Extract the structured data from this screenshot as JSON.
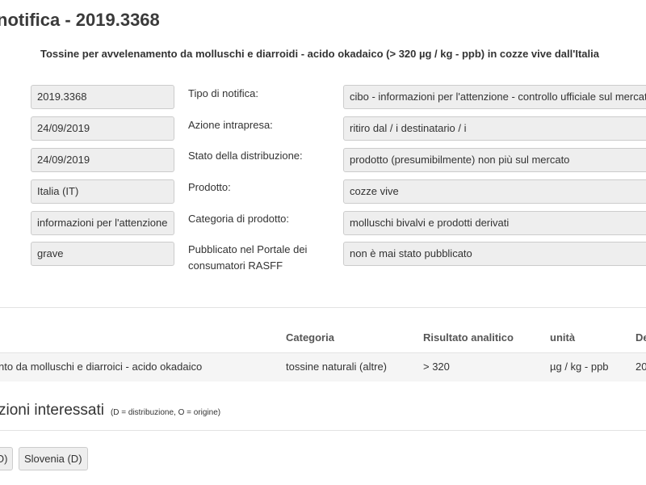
{
  "header": {
    "title": "notifica - 2019.3368",
    "subtitle": "Tossine per avvelenamento da molluschi e diarroidi - acido okadaico (> 320 µg / kg - ppb) in cozze vive dall'Italia"
  },
  "details": {
    "left_values": [
      "2019.3368",
      "24/09/2019",
      "24/09/2019",
      "Italia (IT)",
      "informazioni per l'attenzione",
      "grave"
    ],
    "labels": [
      "Tipo di notifica:",
      "Azione intrapresa:",
      "Stato della distribuzione:",
      "Prodotto:",
      "Categoria di prodotto:",
      "Pubblicato nel Portale dei consumatori RASFF"
    ],
    "right_values": [
      "cibo - informazioni per l'attenzione - controllo ufficiale sul mercato",
      "ritiro dal / i destinatario / i",
      "prodotto (presumibilmente) non più sul mercato",
      "cozze vive",
      "molluschi bivalvi e prodotti derivati",
      "non è mai stato pubblicato"
    ]
  },
  "hazards_table": {
    "headers": [
      "Categoria",
      "Risultato analitico",
      "unità",
      "De"
    ],
    "row": {
      "hazard": "nto da molluschi e diarroici - acido okadaico",
      "category": "tossine naturali (altre)",
      "result": "> 320",
      "unit": "µg / kg - ppb",
      "date": "20"
    }
  },
  "countries": {
    "heading": "zioni interessati",
    "note": "(D = distribuzione, O = origine)",
    "items": [
      "O)",
      "Slovenia (D)"
    ]
  }
}
